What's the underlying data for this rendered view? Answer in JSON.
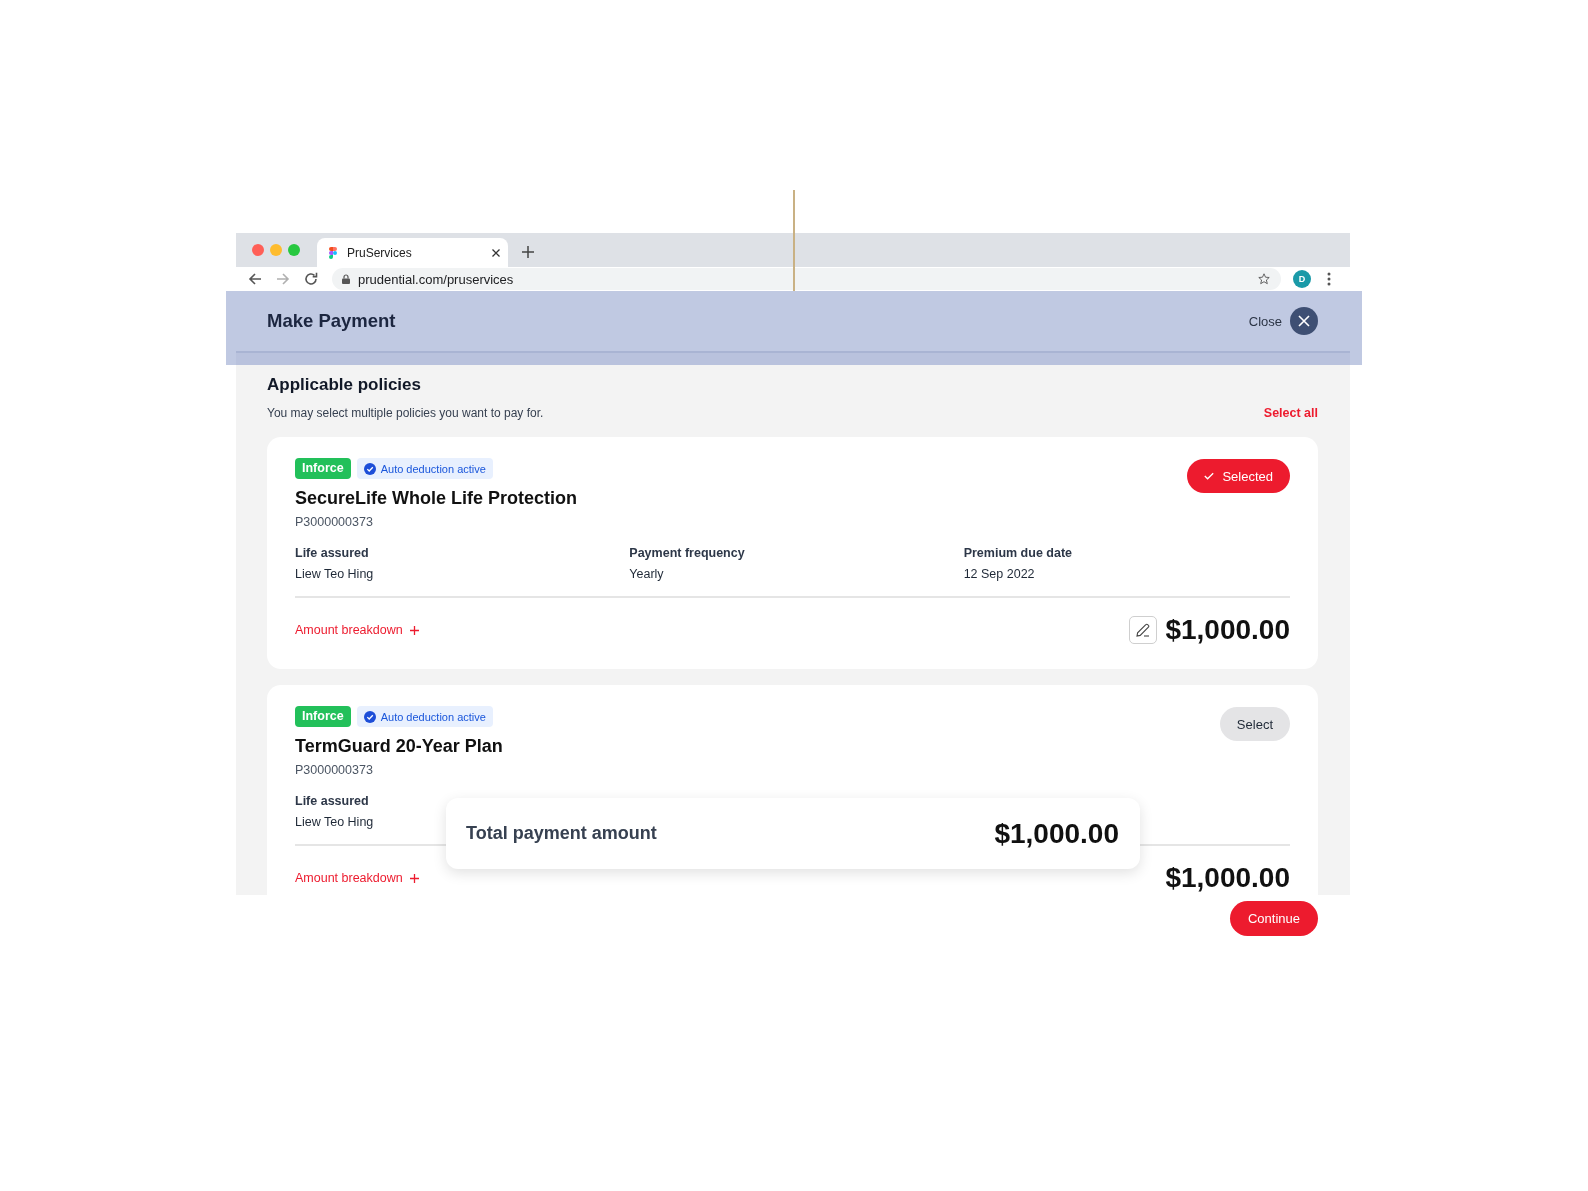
{
  "browser": {
    "tab_title": "PruServices",
    "url": "prudential.com/pruservices",
    "profile_initial": "D"
  },
  "header": {
    "title": "Make Payment",
    "close_label": "Close"
  },
  "section": {
    "title": "Applicable policies",
    "subtitle": "You may select multiple policies you want to pay for.",
    "select_all": "Select all"
  },
  "policies": [
    {
      "status": "Inforce",
      "auto_deduction": "Auto deduction active",
      "name": "SecureLife Whole Life Protection",
      "number": "P3000000373",
      "selected": true,
      "select_label": "Selected",
      "fields": [
        {
          "label": "Life assured",
          "value": "Liew Teo Hing"
        },
        {
          "label": "Payment frequency",
          "value": "Yearly"
        },
        {
          "label": "Premium due date",
          "value": "12 Sep 2022"
        }
      ],
      "breakdown_label": "Amount breakdown",
      "amount": "$1,000.00"
    },
    {
      "status": "Inforce",
      "auto_deduction": "Auto deduction active",
      "name": "TermGuard 20-Year Plan",
      "number": "P3000000373",
      "selected": false,
      "select_label": "Select",
      "fields": [
        {
          "label": "Life assured",
          "value": "Liew Teo Hing"
        }
      ],
      "breakdown_label": "Amount breakdown",
      "amount": "$1,000.00"
    }
  ],
  "total": {
    "label": "Total payment amount",
    "amount": "$1,000.00"
  },
  "continue_label": "Continue"
}
